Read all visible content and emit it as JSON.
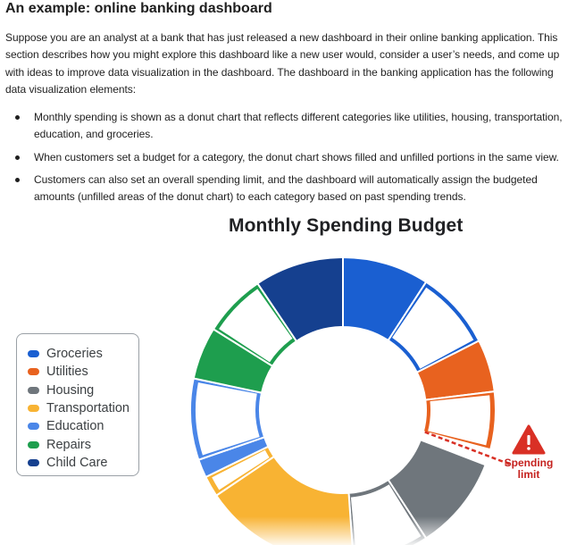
{
  "article": {
    "heading": "An example: online banking dashboard",
    "intro": "Suppose you are an analyst at a bank that has just released a new dashboard in their online banking application. This section describes how you might explore this dashboard like a new user would, consider a user’s needs, and come up with ideas to improve data visualization in the dashboard. The dashboard in the banking application has the following data visualization elements:",
    "bullets": [
      "Monthly spending is shown as a donut chart that reflects different categories like utilities, housing, transportation, education, and groceries.",
      "When customers set a budget for a category, the donut chart shows filled and unfilled portions in the same view.",
      "Customers can also set an overall spending limit, and the dashboard will automatically assign the budgeted amounts (unfilled areas of the donut chart) to each category based on past spending trends."
    ]
  },
  "chart_data": {
    "type": "pie",
    "title": "Monthly Spending Budget",
    "legend_position": "left",
    "categories": [
      "Groceries",
      "Utilities",
      "Housing",
      "Transportation",
      "Education",
      "Repairs",
      "Child Care"
    ],
    "colors": [
      "#1a5fd1",
      "#e8621f",
      "#6f767c",
      "#f8b333",
      "#4a86e8",
      "#1e9e4e",
      "#15408f"
    ],
    "annotation": {
      "text": "Spending limit",
      "icon": "warning-triangle-icon",
      "color": "#d93025"
    }
  }
}
